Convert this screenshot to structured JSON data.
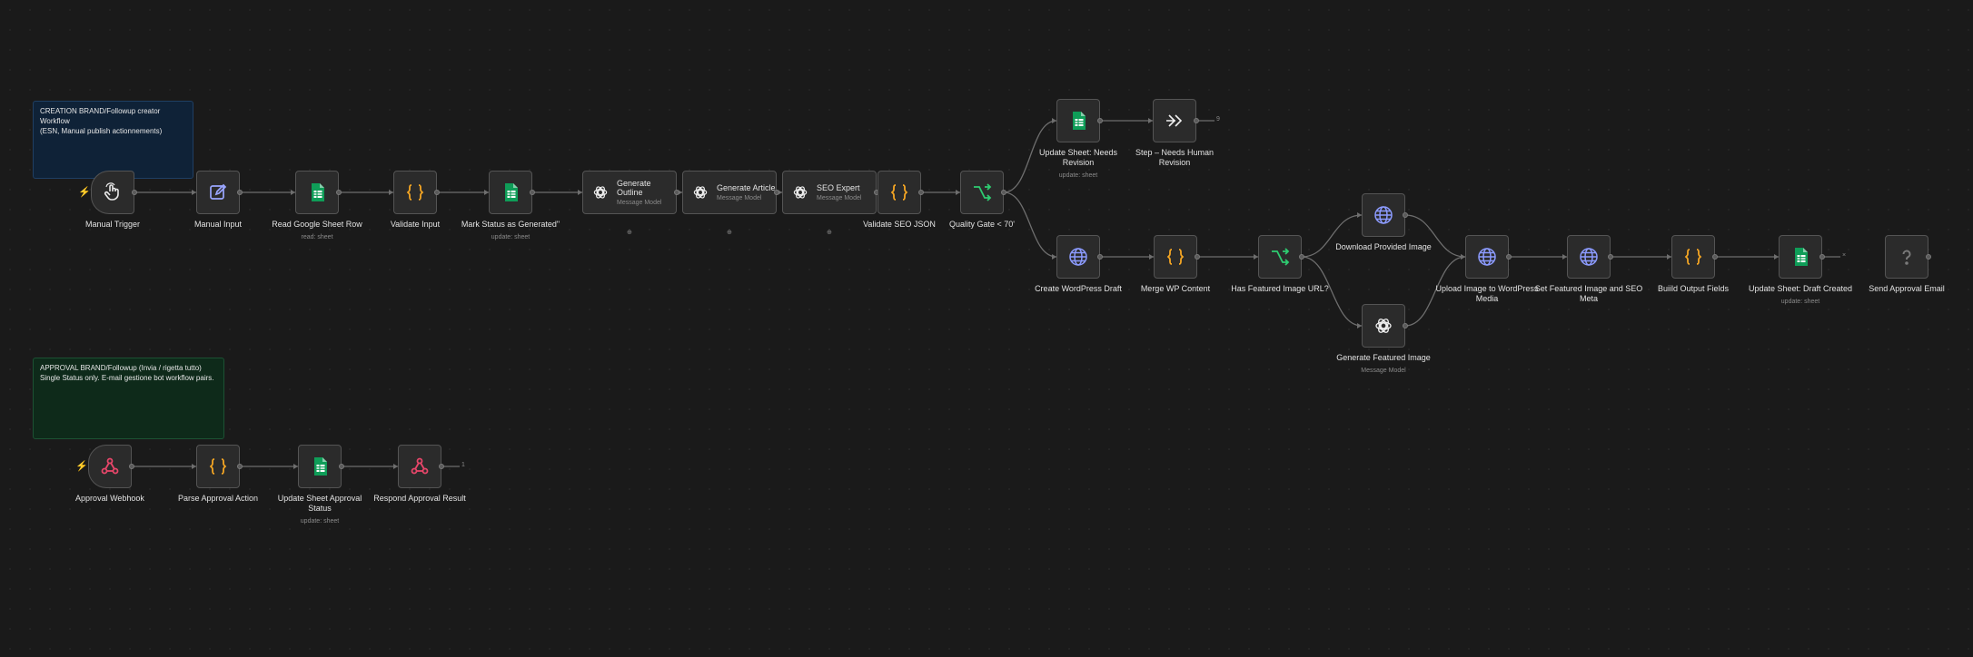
{
  "colors": {
    "background": "#1a1a1a",
    "node": "#2b2b2b",
    "sheets": "#0f9d58",
    "code": "#f5a623",
    "web": "#7b8cff",
    "webhook": "#e8466a",
    "router": "#2ecc71"
  },
  "stickies": [
    {
      "id": "sticky-creation",
      "text": "CREATION BRAND/Followup creator Workflow\n(ESN, Manual publish actionnements)"
    },
    {
      "id": "sticky-approval",
      "text": "APPROVAL BRAND/Followup (Invia / rigetta tutto)\nSingle Status only. E-mail gestione bot workflow pairs."
    }
  ],
  "nodes": {
    "manual_trigger": {
      "label": "Manual Trigger",
      "sub": "",
      "icon": "pointer-icon"
    },
    "manual_input": {
      "label": "Manual Input",
      "sub": "",
      "icon": "edit-icon"
    },
    "read_sheet_row": {
      "label": "Read Google Sheet Row",
      "sub": "read: sheet",
      "icon": "google-sheets-icon"
    },
    "validate_input": {
      "label": "Validate Input",
      "sub": "",
      "icon": "code-icon"
    },
    "mark_status": {
      "label": "Mark Status as Generated\"",
      "sub": "update: sheet",
      "icon": "google-sheets-icon"
    },
    "generate_outline": {
      "label": "Generate Outline",
      "sub": "Message Model",
      "icon": "openai-icon"
    },
    "generate_article": {
      "label": "Generate Article",
      "sub": "Message Model",
      "icon": "openai-icon"
    },
    "seo_expert": {
      "label": "SEO Expert",
      "sub": "Message Model",
      "icon": "openai-icon"
    },
    "validate_seo_json": {
      "label": "Validate SEO JSON",
      "sub": "",
      "icon": "code-icon"
    },
    "quality_gate": {
      "label": "Quality Gate < 70'",
      "sub": "",
      "icon": "router-icon"
    },
    "update_needs_revision": {
      "label": "Update Sheet: Needs Revision",
      "sub": "update: sheet",
      "icon": "google-sheets-icon"
    },
    "step_needs_human": {
      "label": "Step – Needs Human Revision",
      "sub": "",
      "icon": "chevrons-right-icon"
    },
    "create_wp_draft": {
      "label": "Create WordPress Draft",
      "sub": "",
      "icon": "globe-icon"
    },
    "merge_wp_content": {
      "label": "Merge WP Content",
      "sub": "",
      "icon": "code-icon"
    },
    "has_featured_image": {
      "label": "Has Featured Image URL?",
      "sub": "",
      "icon": "router-icon"
    },
    "download_provided_image": {
      "label": "Download Provided Image",
      "sub": "",
      "icon": "globe-icon"
    },
    "generate_featured_image": {
      "label": "Generate Featured Image",
      "sub": "Message Model",
      "icon": "openai-icon"
    },
    "upload_image_wp": {
      "label": "Upload Image to WordPress Media",
      "sub": "",
      "icon": "globe-icon"
    },
    "set_featured_image": {
      "label": "Set Featured Image and SEO Meta",
      "sub": "",
      "icon": "globe-icon"
    },
    "build_output_fields": {
      "label": "Buiild Output Fields",
      "sub": "",
      "icon": "code-icon"
    },
    "update_draft_created": {
      "label": "Update Sheet: Draft Created",
      "sub": "update: sheet",
      "icon": "google-sheets-icon"
    },
    "send_approval_email": {
      "label": "Send Approval Email",
      "sub": "",
      "icon": "question-icon"
    },
    "approval_webhook": {
      "label": "Approval Webhook",
      "sub": "",
      "icon": "webhook-icon"
    },
    "parse_approval_action": {
      "label": "Parse Approval Action",
      "sub": "",
      "icon": "code-icon"
    },
    "update_sheet_approval": {
      "label": "Update Sheet Approval Status",
      "sub": "update: sheet",
      "icon": "google-sheets-icon"
    },
    "respond_approval_result": {
      "label": "Respond Approval Result",
      "sub": "",
      "icon": "webhook-icon"
    }
  },
  "end_port_markers": [
    "9",
    "×",
    "1"
  ],
  "sub_port_markers": [
    "⊕",
    "⊕",
    "⊕"
  ]
}
